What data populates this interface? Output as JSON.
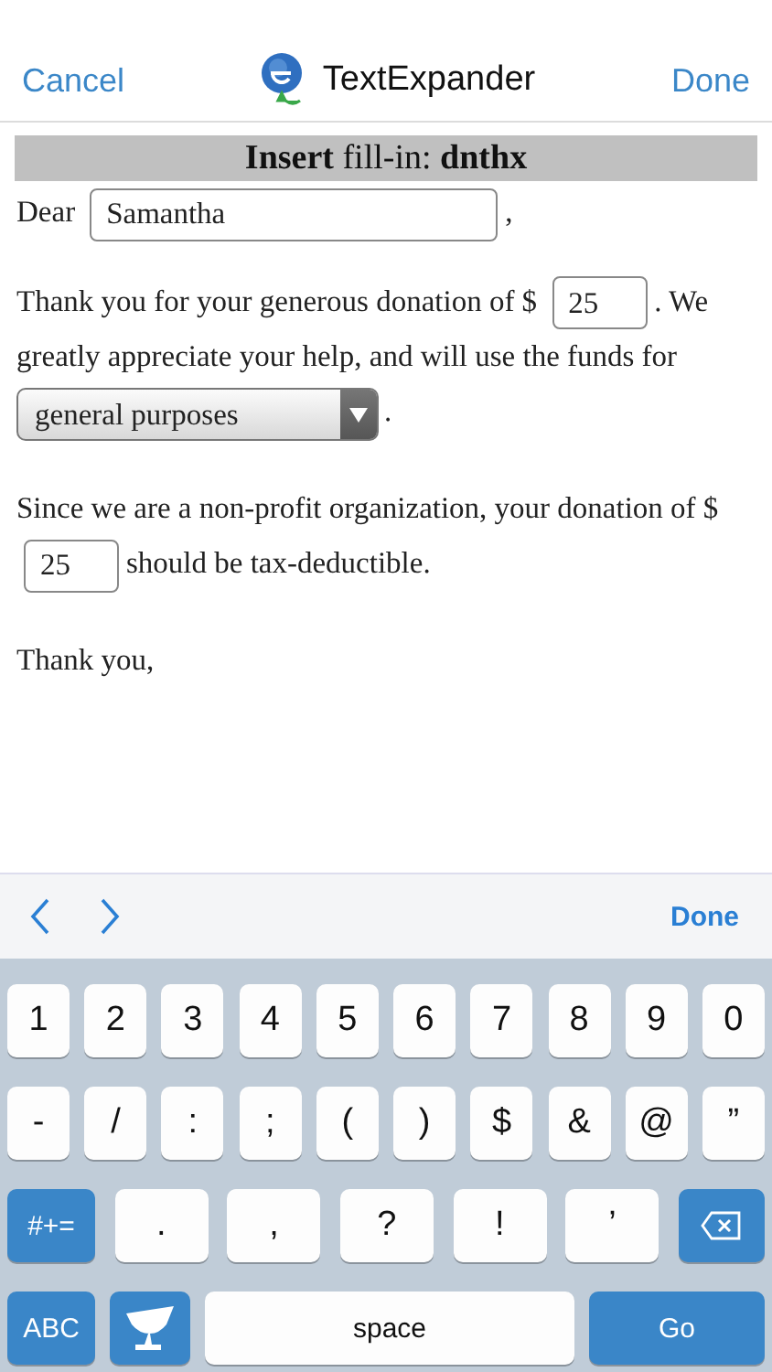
{
  "nav": {
    "cancel": "Cancel",
    "title": "TextExpander",
    "done": "Done"
  },
  "header": "**Insert** fill-in: **dnthx**",
  "letter": [
    {
      "parts": [
        {
          "kind": "text",
          "text": "Dear"
        },
        {
          "kind": "field",
          "value": "Samantha"
        },
        {
          "kind": "text",
          "text": ","
        }
      ]
    },
    {
      "parts": [
        {
          "kind": "text",
          "text": "Thank you for your generous donation of $"
        },
        {
          "kind": "amount",
          "value": "25"
        },
        {
          "kind": "text",
          "text": ". We"
        },
        {
          "kind": "text",
          "text": "greatly appreciate your help, and will use the funds for"
        },
        {
          "kind": "select",
          "value": "general purposes"
        },
        {
          "kind": "text",
          "text": "."
        }
      ]
    },
    {
      "parts": [
        {
          "kind": "text",
          "text": "Since we are a non-profit organization, your donation of $"
        },
        {
          "kind": "amount",
          "value": "25"
        },
        {
          "kind": "text",
          "text": "should be tax-deductible."
        }
      ]
    },
    {
      "parts": [
        {
          "kind": "text",
          "text": "Thank you,"
        }
      ]
    }
  ],
  "toolbar": {
    "done": "Done"
  },
  "keyboard": [
    [
      {
        "kind": "char",
        "label": "1"
      },
      {
        "kind": "char",
        "label": "2"
      },
      {
        "kind": "char",
        "label": "3"
      },
      {
        "kind": "char",
        "label": "4"
      },
      {
        "kind": "char",
        "label": "5"
      },
      {
        "kind": "char",
        "label": "6"
      },
      {
        "kind": "char",
        "label": "7"
      },
      {
        "kind": "char",
        "label": "8"
      },
      {
        "kind": "char",
        "label": "9"
      },
      {
        "kind": "char",
        "label": "0"
      }
    ],
    [
      {
        "kind": "char",
        "label": "-"
      },
      {
        "kind": "char",
        "label": "/"
      },
      {
        "kind": "char",
        "label": ":"
      },
      {
        "kind": "char",
        "label": ";"
      },
      {
        "kind": "char",
        "label": "("
      },
      {
        "kind": "char",
        "label": ")"
      },
      {
        "kind": "char",
        "label": "$"
      },
      {
        "kind": "char",
        "label": "&"
      },
      {
        "kind": "char",
        "label": "@"
      },
      {
        "kind": "char",
        "label": "”"
      }
    ],
    [
      {
        "kind": "mode",
        "label": "#+="
      },
      {
        "kind": "wide",
        "label": "."
      },
      {
        "kind": "wide",
        "label": ","
      },
      {
        "kind": "wide",
        "label": "?"
      },
      {
        "kind": "wide",
        "label": "!"
      },
      {
        "kind": "wide",
        "label": "’"
      },
      {
        "kind": "delete"
      }
    ],
    [
      {
        "kind": "mode",
        "label": "ABC"
      },
      {
        "kind": "logo"
      },
      {
        "kind": "space",
        "label": "space"
      },
      {
        "kind": "go",
        "label": "Go"
      }
    ]
  ]
}
